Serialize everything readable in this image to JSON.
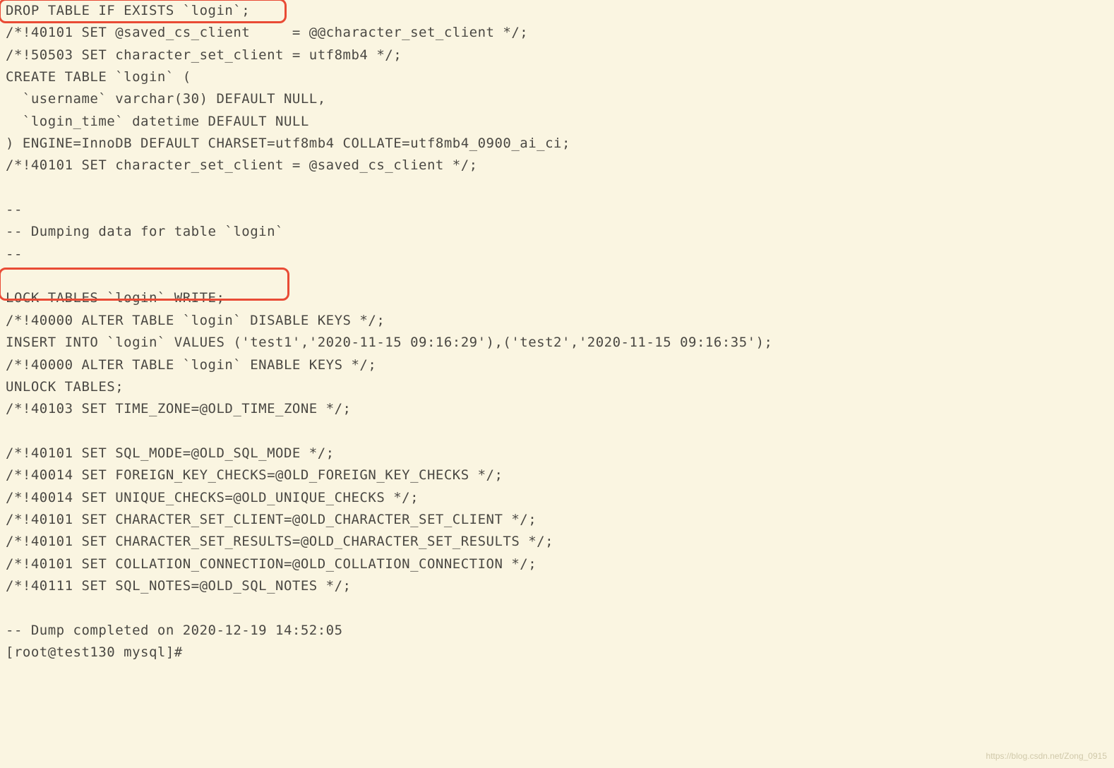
{
  "lines": {
    "l1": "DROP TABLE IF EXISTS `login`;",
    "l2": "/*!40101 SET @saved_cs_client     = @@character_set_client */;",
    "l3": "/*!50503 SET character_set_client = utf8mb4 */;",
    "l4": "CREATE TABLE `login` (",
    "l5": "  `username` varchar(30) DEFAULT NULL,",
    "l6": "  `login_time` datetime DEFAULT NULL",
    "l7": ") ENGINE=InnoDB DEFAULT CHARSET=utf8mb4 COLLATE=utf8mb4_0900_ai_ci;",
    "l8": "/*!40101 SET character_set_client = @saved_cs_client */;",
    "l9": "",
    "l10": "--",
    "l11": "-- Dumping data for table `login`",
    "l12": "--",
    "l13": "",
    "l14": "LOCK TABLES `login` WRITE;",
    "l15": "/*!40000 ALTER TABLE `login` DISABLE KEYS */;",
    "l16": "INSERT INTO `login` VALUES ('test1','2020-11-15 09:16:29'),('test2','2020-11-15 09:16:35');",
    "l17": "/*!40000 ALTER TABLE `login` ENABLE KEYS */;",
    "l18": "UNLOCK TABLES;",
    "l19": "/*!40103 SET TIME_ZONE=@OLD_TIME_ZONE */;",
    "l20": "",
    "l21": "/*!40101 SET SQL_MODE=@OLD_SQL_MODE */;",
    "l22": "/*!40014 SET FOREIGN_KEY_CHECKS=@OLD_FOREIGN_KEY_CHECKS */;",
    "l23": "/*!40014 SET UNIQUE_CHECKS=@OLD_UNIQUE_CHECKS */;",
    "l24": "/*!40101 SET CHARACTER_SET_CLIENT=@OLD_CHARACTER_SET_CLIENT */;",
    "l25": "/*!40101 SET CHARACTER_SET_RESULTS=@OLD_CHARACTER_SET_RESULTS */;",
    "l26": "/*!40101 SET COLLATION_CONNECTION=@OLD_COLLATION_CONNECTION */;",
    "l27": "/*!40111 SET SQL_NOTES=@OLD_SQL_NOTES */;",
    "l28": "",
    "l29": "-- Dump completed on 2020-12-19 14:52:05",
    "l30": "[root@test130 mysql]#"
  },
  "watermark": "https://blog.csdn.net/Zong_0915"
}
